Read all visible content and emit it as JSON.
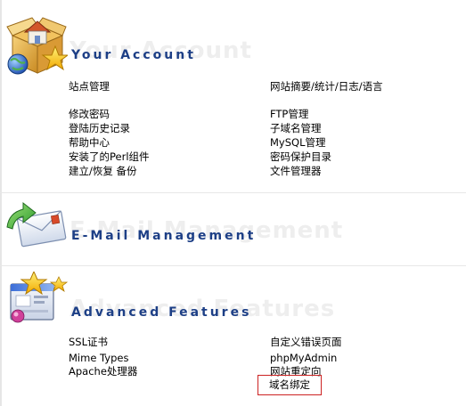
{
  "sections": {
    "account": {
      "watermark": "Your Account",
      "heading": "Your Account",
      "links": [
        {
          "label": "站点管理"
        },
        {
          "label": "网站摘要/统计/日志/语言"
        },
        {
          "label": "修改密码"
        },
        {
          "label": "FTP管理"
        },
        {
          "label": "登陆历史记录"
        },
        {
          "label": "子域名管理"
        },
        {
          "label": "帮助中心"
        },
        {
          "label": "MySQL管理"
        },
        {
          "label": "安装了的Perl组件"
        },
        {
          "label": "密码保护目录"
        },
        {
          "label": "建立/恢复 备份"
        },
        {
          "label": "文件管理器"
        }
      ]
    },
    "email": {
      "watermark": "E-Mail Management",
      "heading": "E-Mail Management"
    },
    "advanced": {
      "watermark": "Advanced Features",
      "heading": "Advanced Features",
      "links": [
        {
          "label": "SSL证书"
        },
        {
          "label": "自定义错误页面"
        },
        {
          "label": "Mime Types"
        },
        {
          "label": "phpMyAdmin"
        },
        {
          "label": "Apache处理器"
        },
        {
          "label": "网站重定向"
        },
        {
          "label": "域名绑定"
        }
      ]
    }
  },
  "colors": {
    "heading": "#1d3f86",
    "watermark": "#eeeeee",
    "highlight_border": "#cc2222"
  },
  "icons": {
    "account": "house-globe-star-icon",
    "email": "mail-arrow-icon",
    "advanced": "window-stars-icon"
  }
}
